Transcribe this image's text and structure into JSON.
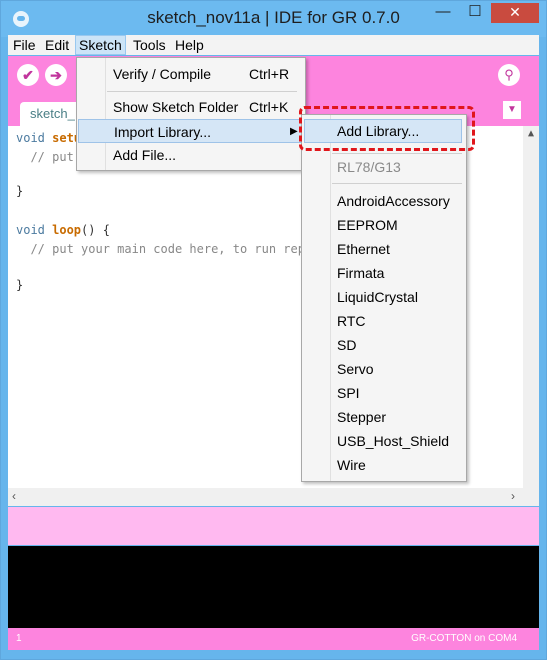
{
  "window": {
    "title": "sketch_nov11a | IDE for GR 0.7.0",
    "controls": {
      "minimize": "—",
      "maximize": "☐",
      "close": "✕"
    }
  },
  "menubar": {
    "items": [
      "File",
      "Edit",
      "Sketch",
      "Tools",
      "Help"
    ]
  },
  "toolbar": {
    "verify_icon": "✔",
    "upload_icon": "➔",
    "serial_icon": "⚲"
  },
  "tabs": {
    "active": "sketch_",
    "menu_icon": "▼"
  },
  "editor": {
    "lines": [
      "void setu",
      "  // put",
      "}",
      "void loop() {",
      "  // put your main code here, to run repeate",
      "}"
    ]
  },
  "sketch_menu": {
    "items": [
      {
        "label": "Verify / Compile",
        "shortcut": "Ctrl+R"
      },
      {
        "label": "Show Sketch Folder",
        "shortcut": "Ctrl+K"
      },
      {
        "label": "Import Library...",
        "arrow": "▶"
      },
      {
        "label": "Add File..."
      }
    ]
  },
  "import_library_submenu": {
    "add_library": "Add Library...",
    "board_header": "RL78/G13",
    "libraries": [
      "AndroidAccessory",
      "EEPROM",
      "Ethernet",
      "Firmata",
      "LiquidCrystal",
      "RTC",
      "SD",
      "Servo",
      "SPI",
      "Stepper",
      "USB_Host_Shield",
      "Wire"
    ]
  },
  "status": {
    "line_number": "1",
    "board": "GR-COTTON on COM4"
  },
  "colors": {
    "accent": "#fd84de",
    "titlebar": "#6cbaf0",
    "highlight": "#e0161b"
  }
}
